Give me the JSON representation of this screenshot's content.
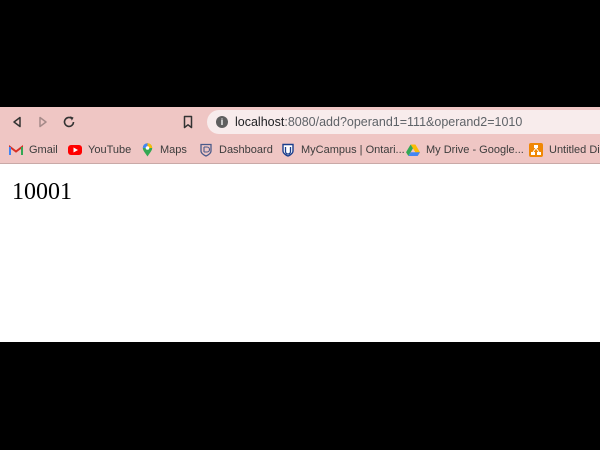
{
  "browser": {
    "toolbar": {
      "back": "back",
      "forward": "forward",
      "reload": "reload"
    },
    "address": {
      "host": "localhost",
      "rest": ":8080/add?operand1=111&operand2=1010"
    },
    "bookmarks": [
      {
        "label": "Gmail",
        "icon": "gmail-icon"
      },
      {
        "label": "YouTube",
        "icon": "youtube-icon"
      },
      {
        "label": "Maps",
        "icon": "maps-icon"
      },
      {
        "label": "Dashboard",
        "icon": "dashboard-icon"
      },
      {
        "label": "MyCampus | Ontari...",
        "icon": "mycampus-icon"
      },
      {
        "label": "My Drive - Google...",
        "icon": "drive-icon"
      },
      {
        "label": "Untitled Dia",
        "icon": "diagram-icon"
      }
    ]
  },
  "page": {
    "result": "10001"
  },
  "colors": {
    "chrome": "#efc6c4",
    "omnibox": "#f8ecec",
    "background": "#000000"
  }
}
